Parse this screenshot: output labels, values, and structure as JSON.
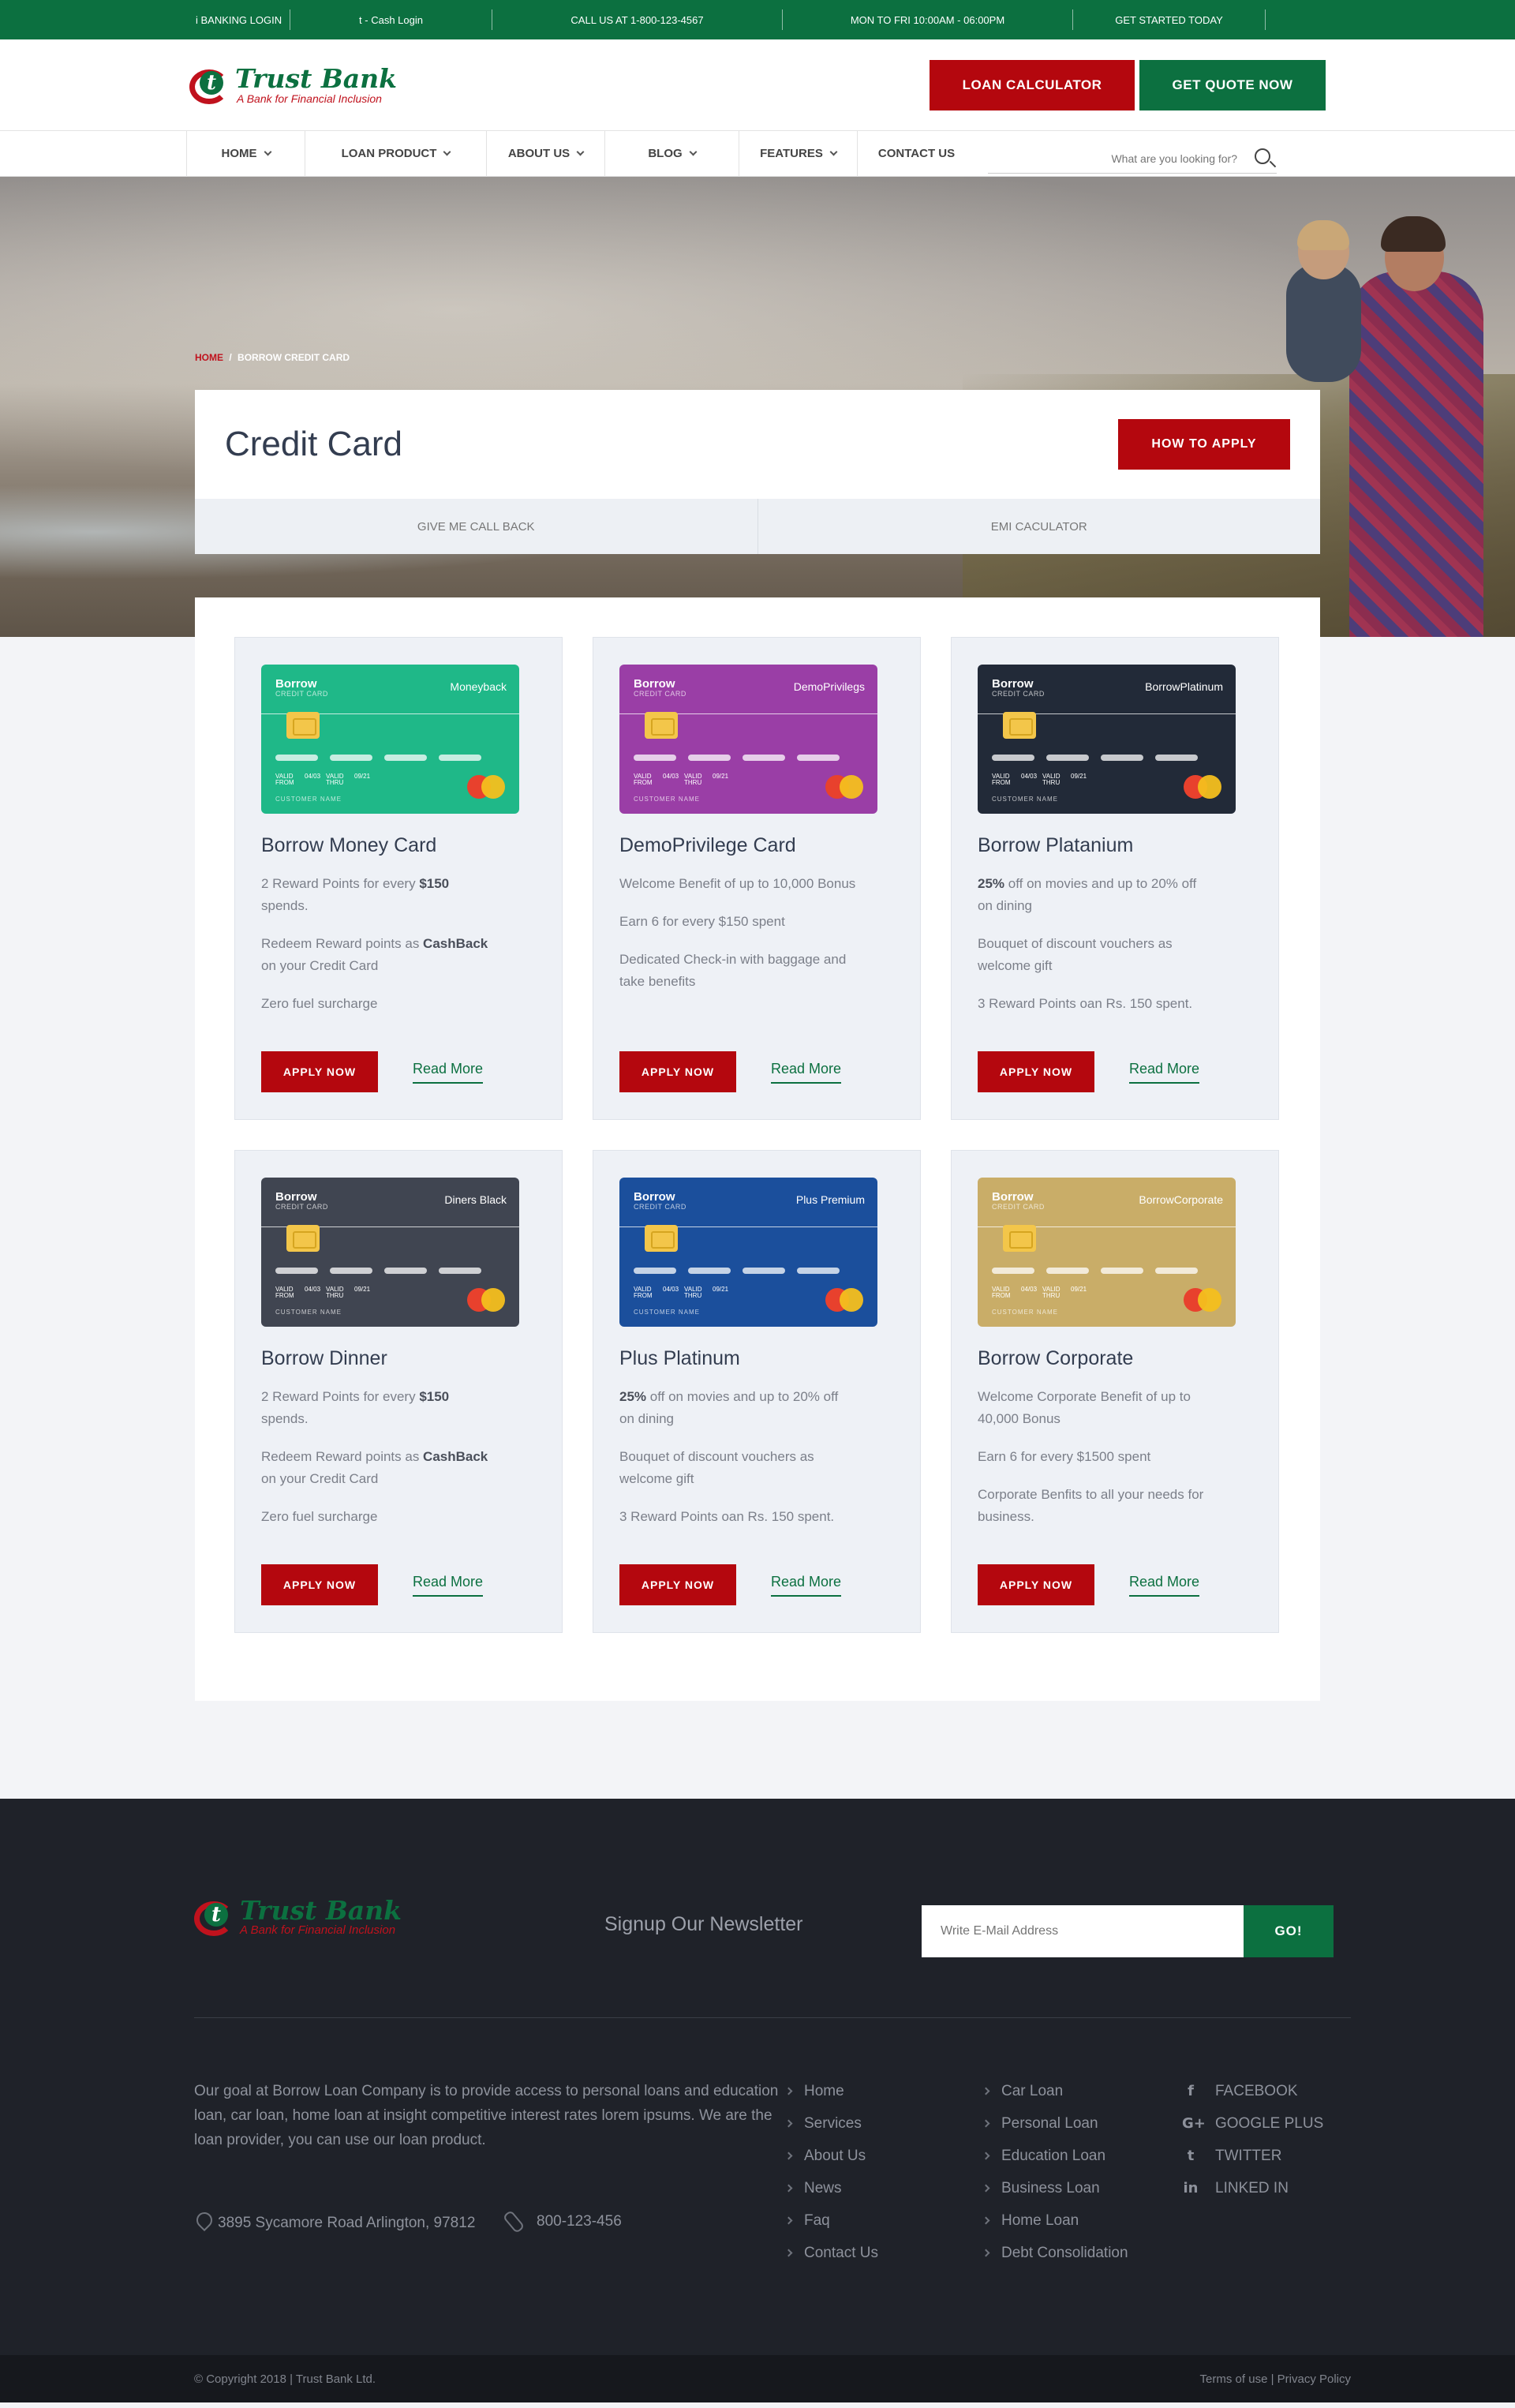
{
  "topbar": {
    "items": [
      "i BANKING LOGIN",
      "t - Cash Login",
      "CALL US AT 1-800-123-4567",
      "MON TO FRI 10:00AM - 06:00PM",
      "GET STARTED TODAY"
    ]
  },
  "brand": {
    "mark": "t",
    "name": "Trust Bank",
    "tagline": "A Bank for Financial Inclusion"
  },
  "header": {
    "loan_calculator": "LOAN CALCULATOR",
    "get_quote": "GET QUOTE NOW"
  },
  "nav": {
    "items": [
      "HOME",
      "LOAN PRODUCT",
      "ABOUT US",
      "BLOG",
      "FEATURES",
      "CONTACT US"
    ],
    "search_placeholder": "What are you looking for?"
  },
  "hero": {
    "breadcrumb_home": "HOME",
    "breadcrumb_sep": "/",
    "breadcrumb_current": "BORROW CREDIT CARD",
    "title": "Credit Card",
    "how_to_apply": "HOW TO APPLY",
    "tabs": [
      "GIVE ME CALL BACK",
      "EMI CACULATOR"
    ]
  },
  "cards": [
    {
      "brand": "Borrow",
      "sub": "CREDIT CARD",
      "kind": "Moneyback",
      "color": "#1fb888",
      "valid_from": "04/03",
      "valid_thru": "09/21",
      "customer": "CUSTOMER NAME",
      "title": "Borrow Money Card",
      "features": [
        {
          "pre": "2 Reward Points for every ",
          "bold": "$150",
          "post": " spends."
        },
        {
          "pre": "Redeem Reward points as ",
          "bold": "CashBack",
          "post": " on your Credit Card"
        },
        {
          "pre": "Zero fuel surcharge",
          "bold": "",
          "post": ""
        }
      ],
      "apply": "APPLY NOW",
      "read": "Read More"
    },
    {
      "brand": "Borrow",
      "sub": "CREDIT CARD",
      "kind": "DemoPrivilegs",
      "color": "#9a3ea6",
      "valid_from": "04/03",
      "valid_thru": "09/21",
      "customer": "CUSTOMER NAME",
      "title": "DemoPrivilege Card",
      "features": [
        {
          "pre": "Welcome Benefit of up to 10,000 Bonus",
          "bold": "",
          "post": ""
        },
        {
          "pre": "Earn 6 for every $150 spent",
          "bold": "",
          "post": ""
        },
        {
          "pre": "Dedicated Check-in with baggage and take benefits",
          "bold": "",
          "post": ""
        }
      ],
      "apply": "APPLY NOW",
      "read": "Read More"
    },
    {
      "brand": "Borrow",
      "sub": "CREDIT CARD",
      "kind": "BorrowPlatinum",
      "color": "#222a38",
      "valid_from": "04/03",
      "valid_thru": "09/21",
      "customer": "CUSTOMER NAME",
      "title": "Borrow Platanium",
      "features": [
        {
          "pre": "",
          "bold": "25%",
          "post": " off on movies and up to 20% off on dining"
        },
        {
          "pre": "Bouquet of discount vouchers as welcome gift",
          "bold": "",
          "post": ""
        },
        {
          "pre": "3 Reward Points oan Rs. 150 spent.",
          "bold": "",
          "post": ""
        }
      ],
      "apply": "APPLY NOW",
      "read": "Read More"
    },
    {
      "brand": "Borrow",
      "sub": "CREDIT CARD",
      "kind": "Diners Black",
      "color": "#404551",
      "valid_from": "04/03",
      "valid_thru": "09/21",
      "customer": "CUSTOMER NAME",
      "title": "Borrow Dinner",
      "features": [
        {
          "pre": "2 Reward Points for every ",
          "bold": "$150",
          "post": " spends."
        },
        {
          "pre": "Redeem Reward points as ",
          "bold": "CashBack",
          "post": " on your Credit Card"
        },
        {
          "pre": "Zero fuel surcharge",
          "bold": "",
          "post": ""
        }
      ],
      "apply": "APPLY NOW",
      "read": "Read More"
    },
    {
      "brand": "Borrow",
      "sub": "CREDIT CARD",
      "kind": "Plus Premium",
      "color": "#1b4f9c",
      "valid_from": "04/03",
      "valid_thru": "09/21",
      "customer": "CUSTOMER NAME",
      "title": "Plus Platinum",
      "features": [
        {
          "pre": "",
          "bold": "25%",
          "post": " off on movies and up to 20% off on dining"
        },
        {
          "pre": "Bouquet of discount vouchers as welcome gift",
          "bold": "",
          "post": ""
        },
        {
          "pre": "3 Reward Points oan Rs. 150 spent.",
          "bold": "",
          "post": ""
        }
      ],
      "apply": "APPLY NOW",
      "read": "Read More"
    },
    {
      "brand": "Borrow",
      "sub": "CREDIT CARD",
      "kind": "BorrowCorporate",
      "color": "#c9ad68",
      "valid_from": "04/03",
      "valid_thru": "09/21",
      "customer": "CUSTOMER NAME",
      "title": "Borrow Corporate",
      "features": [
        {
          "pre": "Welcome Corporate Benefit of up to 40,000 Bonus",
          "bold": "",
          "post": ""
        },
        {
          "pre": "Earn 6 for every $1500 spent",
          "bold": "",
          "post": ""
        },
        {
          "pre": "Corporate Benfits to all your needs for business.",
          "bold": "",
          "post": ""
        }
      ],
      "apply": "APPLY NOW",
      "read": "Read More"
    }
  ],
  "card_labels": {
    "valid_from": "VALID FROM",
    "valid_thru": "VALID THRU"
  },
  "footer": {
    "newsletter_title": "Signup Our Newsletter",
    "email_placeholder": "Write E-Mail Address",
    "go": "GO!",
    "about": "Our goal at Borrow Loan Company is to provide access to personal loans and education loan, car loan, home loan at insight competitive interest rates lorem ipsums. We are the loan provider, you can use our loan product.",
    "address": "3895 Sycamore Road Arlington, 97812",
    "phone": "800-123-456",
    "links1": [
      "Home",
      "Services",
      "About Us",
      "News",
      "Faq",
      "Contact Us"
    ],
    "links2": [
      "Car Loan",
      "Personal Loan",
      "Education Loan",
      "Business Loan",
      "Home Loan",
      "Debt Consolidation"
    ],
    "social": [
      {
        "icon": "facebook-icon",
        "glyph": "f",
        "label": "FACEBOOK"
      },
      {
        "icon": "google-plus-icon",
        "glyph": "G+",
        "label": "GOOGLE PLUS"
      },
      {
        "icon": "twitter-icon",
        "glyph": "t",
        "label": "TWITTER"
      },
      {
        "icon": "linkedin-icon",
        "glyph": "in",
        "label": "LINKED IN"
      }
    ],
    "copyright": "© Copyright 2018 | Trust Bank Ltd.",
    "terms": "Terms of use | Privacy Policy"
  }
}
